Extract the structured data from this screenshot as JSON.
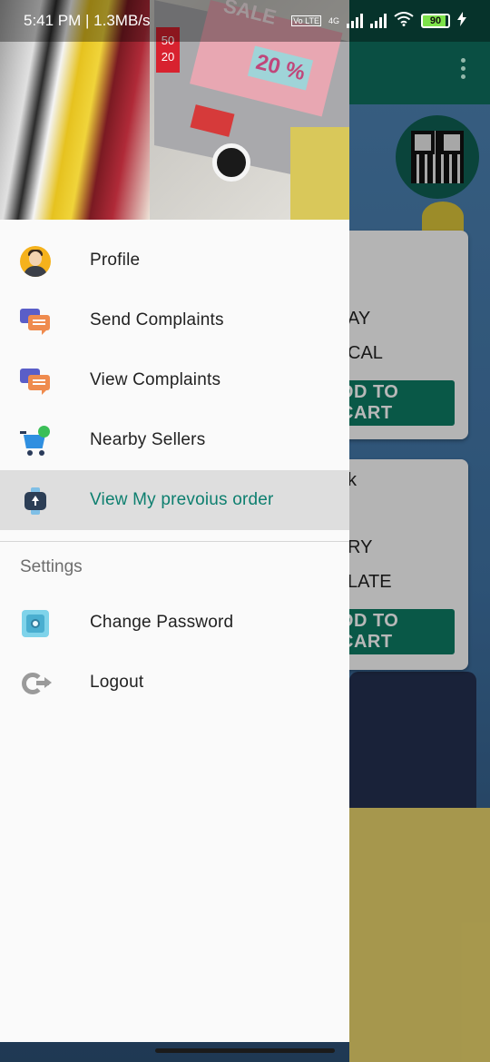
{
  "status_bar": {
    "time_speed": "5:41 PM | 1.3MB/s",
    "network": "4G",
    "volte": "Vo LTE",
    "battery": "90"
  },
  "drawer_header": {
    "sale_text": "SALE",
    "discount_text": "20 %",
    "tag_text": "50 20"
  },
  "menu": {
    "items": [
      {
        "label": "Profile",
        "icon": "avatar-icon"
      },
      {
        "label": "Send Complaints",
        "icon": "chat-icon"
      },
      {
        "label": "View Complaints",
        "icon": "chat-icon"
      },
      {
        "label": "Nearby Sellers",
        "icon": "cart-icon"
      },
      {
        "label": "View My prevoius order",
        "icon": "watch-upload-icon",
        "active": true
      }
    ],
    "settings_title": "Settings",
    "settings_items": [
      {
        "label": "Change Password",
        "icon": "safe-icon"
      },
      {
        "label": "Logout",
        "icon": "logout-icon"
      }
    ]
  },
  "background_app": {
    "cards": [
      {
        "lines": [
          "AY",
          "CAL"
        ],
        "button": "DD TO CART"
      },
      {
        "lines": [
          "k",
          "RY",
          "LATE"
        ],
        "button": "DD TO CART"
      }
    ]
  },
  "colors": {
    "accent": "#0d7f6f",
    "toolbar": "#0f6e5e",
    "active_bg": "#dedede"
  }
}
